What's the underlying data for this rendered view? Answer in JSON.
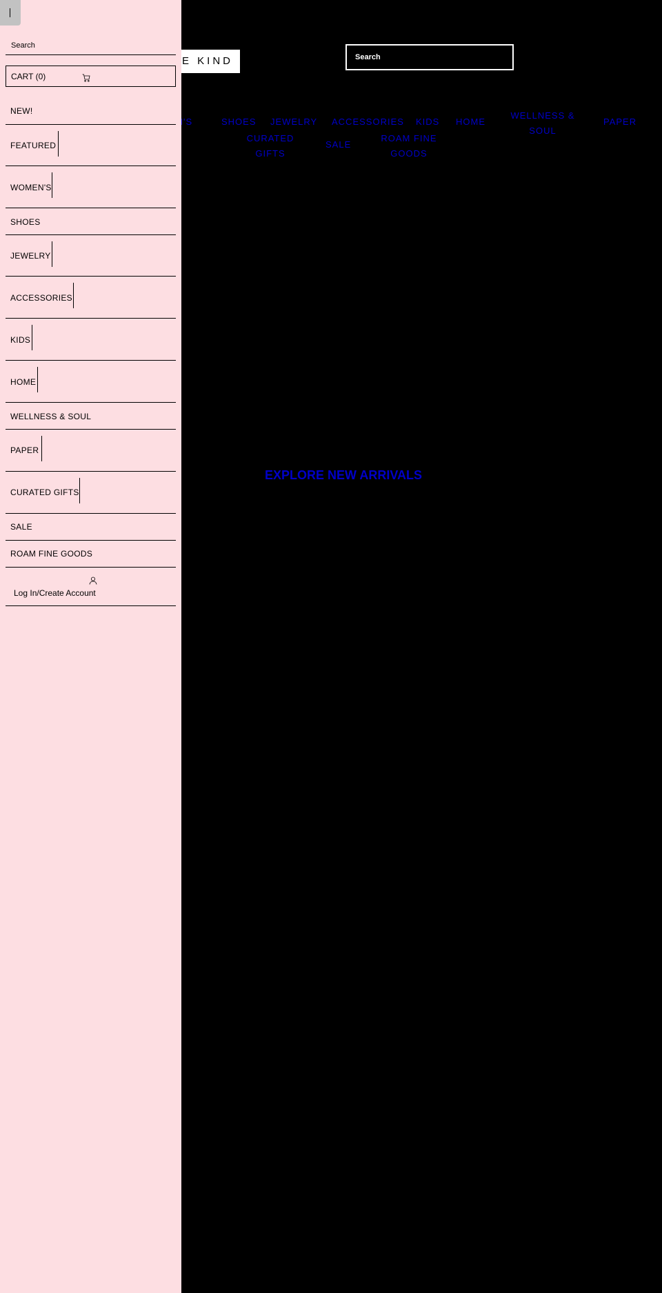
{
  "header": {
    "logo_text": "HE KIND",
    "search_placeholder": "Search"
  },
  "nav": {
    "links": [
      "EN'S",
      "SHOES",
      "JEWELRY",
      "ACCESSORIES",
      "KIDS",
      "HOME",
      "WELLNESS & SOUL",
      "PAPER",
      "CURATED GIFTS",
      "SALE",
      "ROAM FINE GOODS"
    ],
    "link_color": "#0000c8"
  },
  "hero": {
    "cta": "EXPLORE NEW ARRIVALS"
  },
  "drawer": {
    "background": "#fddee2",
    "search_placeholder": "Search",
    "cart_label": "CART (0)",
    "items": [
      {
        "label": "NEW!"
      },
      {
        "label": "FEATURED"
      },
      {
        "label": "WOMEN'S"
      },
      {
        "label": "SHOES"
      },
      {
        "label": "JEWELRY"
      },
      {
        "label": "ACCESSORIES"
      },
      {
        "label": "KIDS"
      },
      {
        "label": "HOME"
      },
      {
        "label": "WELLNESS & SOUL"
      },
      {
        "label": "PAPER"
      },
      {
        "label": "CURATED GIFTS"
      },
      {
        "label": "SALE"
      },
      {
        "label": "ROAM FINE GOODS"
      }
    ],
    "account_label": "Log In/Create Account"
  }
}
